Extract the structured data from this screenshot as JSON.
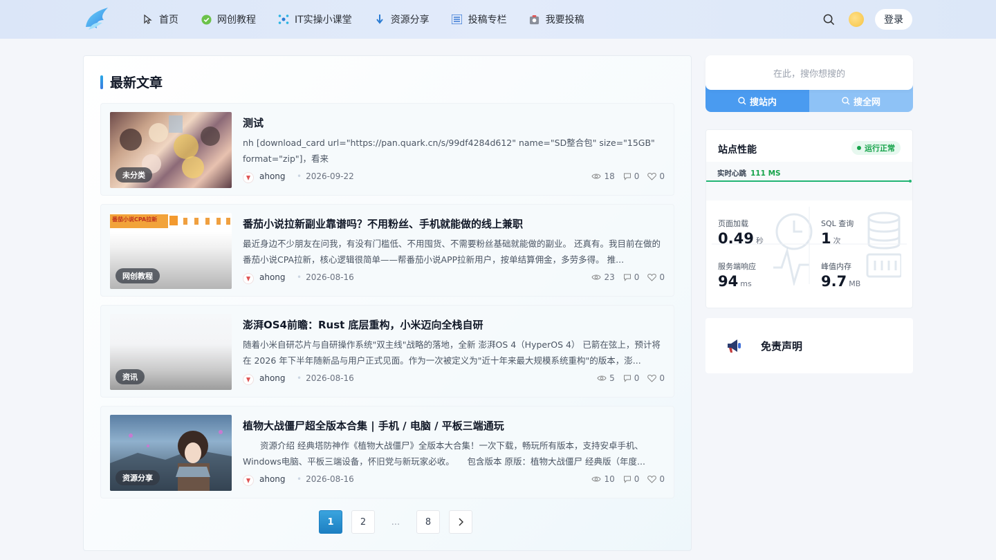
{
  "header": {
    "nav": [
      {
        "label": "首页",
        "icon": "cursor-icon"
      },
      {
        "label": "网创教程",
        "icon": "check-circle-icon"
      },
      {
        "label": "IT实操小课堂",
        "icon": "network-icon"
      },
      {
        "label": "资源分享",
        "icon": "download-arrow-icon"
      },
      {
        "label": "投稿专栏",
        "icon": "list-icon"
      },
      {
        "label": "我要投稿",
        "icon": "submit-icon"
      }
    ],
    "login_label": "登录"
  },
  "main": {
    "section_title": "最新文章",
    "posts": [
      {
        "title": "测试",
        "excerpt": "nh [download_card url=\"https://pan.quark.cn/s/99df4284d612\" name=\"SD整合包\" size=\"15GB\" format=\"zip\"]，看来",
        "category": "未分类",
        "author": "ahong",
        "date": "2026-09-22",
        "views": "18",
        "comments": "0",
        "likes": "0"
      },
      {
        "title": "番茄小说拉新副业靠谱吗？不用粉丝、手机就能做的线上兼职",
        "excerpt": "最近身边不少朋友在问我，有没有门槛低、不用囤货、不需要粉丝基础就能做的副业。 还真有。我目前在做的番茄小说CPA拉新，核心逻辑很简单——帮番茄小说APP拉新用户，按单结算佣金，多劳多得。 推...",
        "category": "网创教程",
        "author": "ahong",
        "date": "2026-08-16",
        "views": "23",
        "comments": "0",
        "likes": "0",
        "thumb_text": "番茄小说CPA拉新"
      },
      {
        "title": "澎湃OS4前瞻：Rust 底层重构，小米迈向全栈自研",
        "excerpt": "随着小米自研芯片与自研操作系统\"双主线\"战略的落地，全新 澎湃OS 4（HyperOS 4） 已箭在弦上，预计将在 2026 年下半年随新品与用户正式见面。作为一次被定义为\"近十年来最大规模系统重构\"的版本，澎...",
        "category": "资讯",
        "author": "ahong",
        "date": "2026-08-16",
        "views": "5",
        "comments": "0",
        "likes": "0"
      },
      {
        "title": "植物大战僵尸超全版本合集 | 手机 / 电脑 / 平板三端通玩",
        "excerpt": "　　资源介绍 经典塔防神作《植物大战僵尸》全版本大合集！一次下载，畅玩所有版本，支持安卓手机、Windows电脑、平板三端设备，怀旧党与新玩家必收。　　包含版本 原版：植物大战僵尸 经典版（年度...",
        "category": "资源分享",
        "author": "ahong",
        "date": "2026-08-16",
        "views": "10",
        "comments": "0",
        "likes": "0"
      }
    ],
    "pagination": [
      "1",
      "2",
      "...",
      "8"
    ]
  },
  "sidebar": {
    "search": {
      "placeholder": "在此，搜你想搜的",
      "tab_site": "搜站内",
      "tab_web": "搜全网"
    },
    "perf": {
      "title": "站点性能",
      "status": "运行正常",
      "heartbeat_label": "实时心跳",
      "heartbeat_value": "111 MS",
      "metrics": [
        {
          "label": "页面加载",
          "value": "0.49",
          "unit": "秒"
        },
        {
          "label": "SQL 查询",
          "value": "1",
          "unit": "次"
        },
        {
          "label": "服务端响应",
          "value": "94",
          "unit": "ms"
        },
        {
          "label": "峰值内存",
          "value": "9.7",
          "unit": "MB"
        }
      ]
    },
    "disclaimer": "免责声明"
  },
  "colors": {
    "accent": "#3b8fe6",
    "status_green": "#16a34a",
    "header_bg": "#dce7f8"
  }
}
